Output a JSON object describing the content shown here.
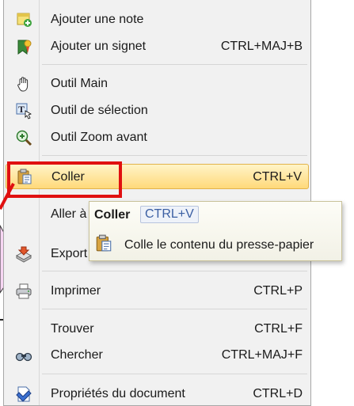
{
  "menu": {
    "items": [
      {
        "id": "add-note",
        "label": "Ajouter une note",
        "shortcut": "",
        "icon": "add-note-icon"
      },
      {
        "id": "add-bookmark",
        "label": "Ajouter un signet",
        "shortcut": "CTRL+MAJ+B",
        "icon": "bookmark-icon"
      },
      {
        "id": "hand-tool",
        "label": "Outil Main",
        "shortcut": "",
        "icon": "hand-icon"
      },
      {
        "id": "select-tool",
        "label": "Outil de sélection",
        "shortcut": "",
        "icon": "text-select-icon"
      },
      {
        "id": "zoom-tool",
        "label": "Outil Zoom avant",
        "shortcut": "",
        "icon": "zoom-in-icon"
      },
      {
        "id": "paste",
        "label": "Coller",
        "shortcut": "CTRL+V",
        "icon": "paste-icon"
      },
      {
        "id": "goto",
        "label": "Aller à",
        "shortcut": "",
        "icon": ""
      },
      {
        "id": "export",
        "label": "Export",
        "shortcut": "",
        "icon": "export-icon"
      },
      {
        "id": "print",
        "label": "Imprimer",
        "shortcut": "CTRL+P",
        "icon": "printer-icon"
      },
      {
        "id": "find",
        "label": "Trouver",
        "shortcut": "CTRL+F",
        "icon": ""
      },
      {
        "id": "search",
        "label": "Chercher",
        "shortcut": "CTRL+MAJ+F",
        "icon": "binoculars-icon"
      },
      {
        "id": "properties",
        "label": "Propriétés du document",
        "shortcut": "CTRL+D",
        "icon": "properties-icon"
      }
    ]
  },
  "tooltip": {
    "title": "Coller",
    "shortcut": "CTRL+V",
    "description": "Colle le contenu du presse-papier"
  },
  "colors": {
    "highlight": "#ffd97a",
    "annotation": "#e01010",
    "tooltip_key": "#3b5fa3"
  }
}
